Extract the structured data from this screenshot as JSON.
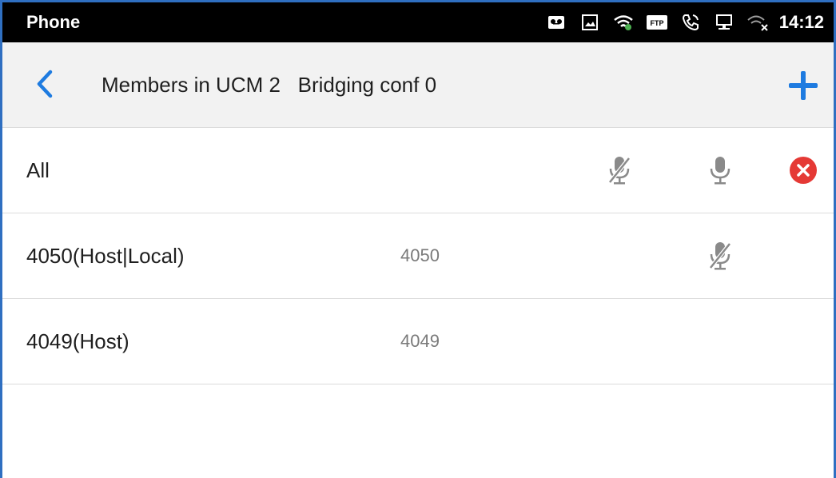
{
  "status_bar": {
    "app_name": "Phone",
    "time": "14:12",
    "icons": [
      "voicemail-icon",
      "image-icon",
      "wifi-icon",
      "ftp-icon",
      "phone-call-icon",
      "network-icon",
      "wifi-off-icon"
    ],
    "ftp_label": "FTP"
  },
  "header": {
    "title": "Members in UCM 2   Bridging conf 0",
    "back_icon": "chevron-left-icon",
    "add_icon": "plus-icon",
    "accent_color": "#1e7be0"
  },
  "members": [
    {
      "name": "All",
      "number": "",
      "actions": [
        "mute-all-icon",
        "unmute-all-icon",
        "kick-all-icon"
      ]
    },
    {
      "name": "4050(Host|Local)",
      "number": "4050",
      "actions": [
        "mic-muted-icon"
      ]
    },
    {
      "name": "4049(Host)",
      "number": "4049",
      "actions": []
    }
  ],
  "colors": {
    "status_bar_bg": "#000000",
    "header_bg": "#f2f2f2",
    "icon_gray": "#8a8a8a",
    "danger": "#e53935",
    "frame_border": "#2f6fc1"
  }
}
